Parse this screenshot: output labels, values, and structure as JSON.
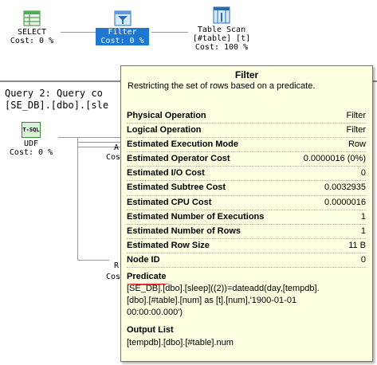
{
  "plan1": {
    "select": {
      "name": "SELECT",
      "cost": "Cost: 0 %"
    },
    "filter": {
      "name": "Filter",
      "cost": "Cost: 0 %"
    },
    "table_scan": {
      "name": "Table Scan",
      "object": "[#table] [t]",
      "cost": "Cost: 100 %"
    }
  },
  "query2": {
    "header": "Query 2: Query co",
    "subheader": "[SE_DB].[dbo].[sle",
    "udf": {
      "icon_text": "T-SQL",
      "name": "UDF",
      "cost": "Cost: 0 %"
    },
    "partial": {
      "a": "A",
      "cos1": "Cos",
      "r": "R",
      "cos2": "Cos"
    }
  },
  "tooltip": {
    "title": "Filter",
    "description": "Restricting the set of rows based on a predicate.",
    "properties": [
      {
        "key": "Physical Operation",
        "value": "Filter"
      },
      {
        "key": "Logical Operation",
        "value": "Filter"
      },
      {
        "key": "Estimated Execution Mode",
        "value": "Row"
      },
      {
        "key": "Estimated Operator Cost",
        "value": "0.0000016 (0%)"
      },
      {
        "key": "Estimated I/O Cost",
        "value": "0"
      },
      {
        "key": "Estimated Subtree Cost",
        "value": "0.0032935"
      },
      {
        "key": "Estimated CPU Cost",
        "value": "0.0000016"
      },
      {
        "key": "Estimated Number of Executions",
        "value": "1"
      },
      {
        "key": "Estimated Number of Rows",
        "value": "1"
      },
      {
        "key": "Estimated Row Size",
        "value": "11 B"
      },
      {
        "key": "Node ID",
        "value": "0"
      }
    ],
    "predicate_label": "Predicate",
    "predicate_lines": [
      "[SE_DB].[dbo].[sleep]((2))=dateadd(day,[tempdb].",
      "[dbo].[#table].[num] as [t].[num],'1900-01-01",
      "00:00:00.000')"
    ],
    "output_label": "Output List",
    "output_value": "[tempdb].[dbo].[#table].num"
  },
  "colors": {
    "selected": "#1e78d2",
    "tooltip_bg": "#ffffe1",
    "underline": "#e02020"
  },
  "icons": [
    "select-icon",
    "filter-icon",
    "table-scan-icon",
    "tsql-udf-icon"
  ]
}
